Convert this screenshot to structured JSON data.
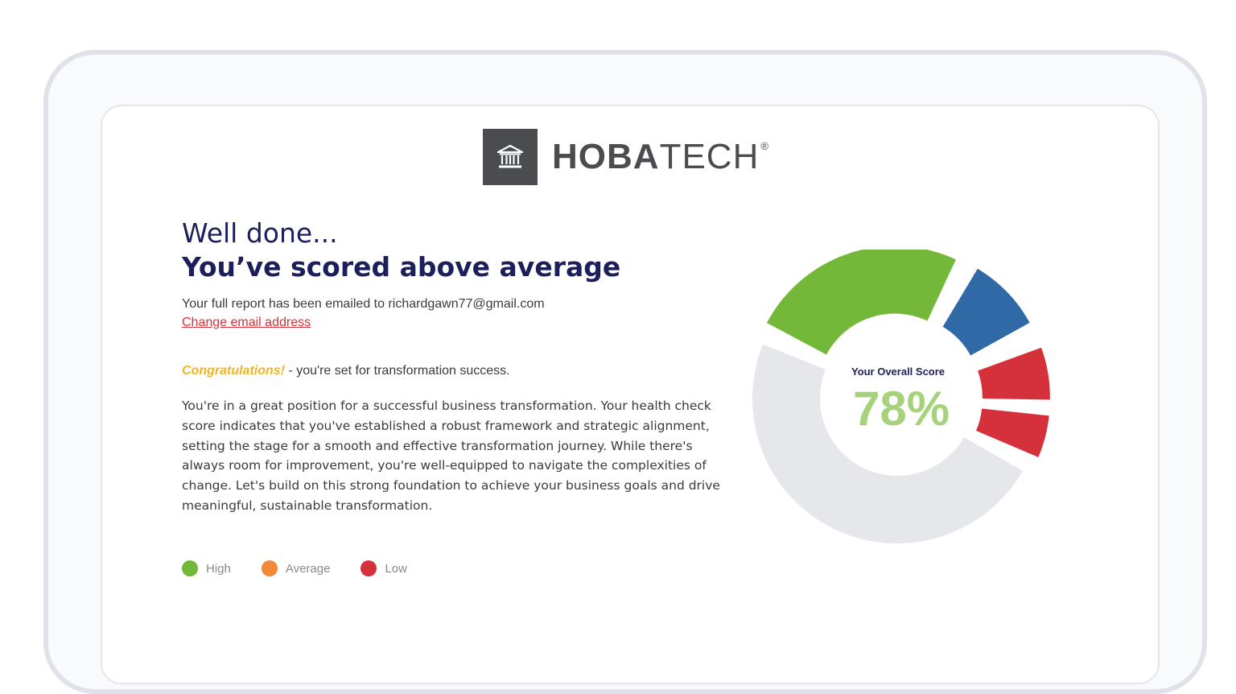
{
  "brand": {
    "name_bold": "HOBA",
    "name_regular": "TECH",
    "registered": "®"
  },
  "result": {
    "heading_line1": "Well done...",
    "heading_line2": "You’ve scored above average",
    "email_note": "Your full report has been emailed to richardgawn77@gmail.com",
    "change_email_link": "Change email address",
    "congrats_emphasis": "Congratulations!",
    "congrats_rest": " - you're set for transformation success.",
    "body": "You're in a great position for a successful business transformation. Your health check score indicates that you've established a robust framework and strategic alignment, setting the stage for a smooth and effective transformation journey. While there's always room for improvement, you're well-equipped to navigate the complexities of change. Let's build on this strong foundation to achieve your business goals and drive meaningful, sustainable transformation."
  },
  "legend": [
    {
      "label": "High",
      "color": "#74b83a"
    },
    {
      "label": "Average",
      "color": "#f08a37"
    },
    {
      "label": "Low",
      "color": "#d5313a"
    }
  ],
  "score": {
    "caption": "Your Overall Score",
    "value": 78,
    "display": "78%",
    "value_color": "#a6d27c"
  },
  "chart_data": {
    "type": "pie",
    "slices": [
      {
        "category": "High",
        "color": "#74b83a",
        "start_deg": -62,
        "end_deg": 25,
        "explode": 1
      },
      {
        "category": "Blue",
        "color": "#2f6aa7",
        "start_deg": 31,
        "end_deg": 61,
        "explode": 1
      },
      {
        "category": "Low",
        "color": "#d5313a",
        "start_deg": 70,
        "end_deg": 91,
        "explode": 1
      },
      {
        "category": "Low",
        "color": "#d5313a",
        "start_deg": 96,
        "end_deg": 113,
        "explode": 1
      },
      {
        "category": "Remaining",
        "color": "#e5e7eb",
        "start_deg": 120,
        "end_deg": 292,
        "explode": 0
      }
    ]
  }
}
